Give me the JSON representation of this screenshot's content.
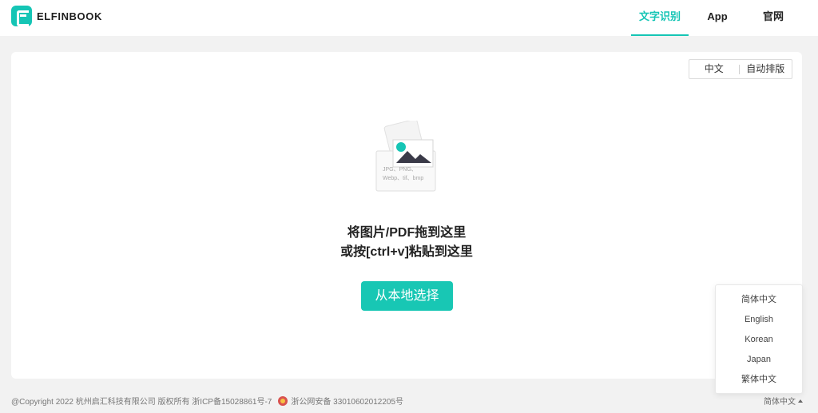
{
  "header": {
    "logo_text": "ELFINBOOK",
    "nav": [
      {
        "label": "文字识别",
        "active": true
      },
      {
        "label": "App",
        "active": false
      },
      {
        "label": "官网",
        "active": false
      }
    ]
  },
  "toolbar": {
    "lang_button": "中文",
    "layout_button": "自动排版"
  },
  "upload": {
    "formats_line1": "JPG、PNG、",
    "formats_line2": "Webp、tif、bmp",
    "drop_line1": "将图片/PDF拖到这里",
    "drop_line2": "或按[ctrl+v]粘贴到这里",
    "pick_button": "从本地选择"
  },
  "language_menu": {
    "options": [
      "简体中文",
      "English",
      "Korean",
      "Japan",
      "繁体中文"
    ]
  },
  "footer": {
    "copyright": "@Copyright 2022 杭州启汇科技有限公司 版权所有 浙ICP备15028861号-7",
    "police_record": "浙公网安备 33010602012205号",
    "language_switch": "简体中文"
  },
  "colors": {
    "accent": "#15c5b5",
    "background": "#f2f2f2"
  }
}
